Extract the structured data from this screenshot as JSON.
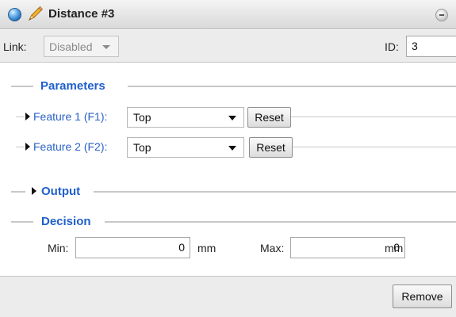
{
  "titlebar": {
    "title": "Distance #3"
  },
  "link": {
    "label": "Link:",
    "value": "Disabled"
  },
  "id": {
    "label": "ID:",
    "value": "3"
  },
  "parameters": {
    "title": "Parameters",
    "features": [
      {
        "label": "Feature 1 (F1):",
        "value": "Top",
        "reset_label": "Reset"
      },
      {
        "label": "Feature 2 (F2):",
        "value": "Top",
        "reset_label": "Reset"
      }
    ]
  },
  "output": {
    "title": "Output"
  },
  "decision": {
    "title": "Decision",
    "min_label": "Min:",
    "min_value": "0",
    "min_unit": "mm",
    "max_label": "Max:",
    "max_value": "0",
    "max_unit": "mm"
  },
  "footer": {
    "remove_label": "Remove"
  },
  "colors": {
    "section_title": "#1f5fcc",
    "feature_label": "#2a62c8",
    "title_icon": "#1e6fbf"
  }
}
